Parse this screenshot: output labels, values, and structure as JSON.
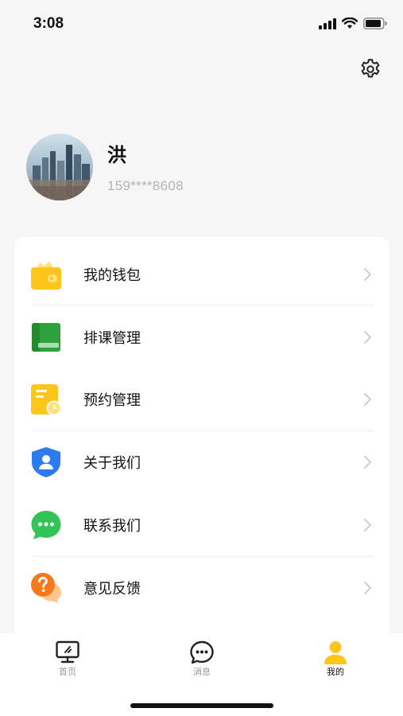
{
  "status_bar": {
    "time": "3:08"
  },
  "profile": {
    "name": "洪",
    "phone": "159****8608"
  },
  "menu": {
    "items": [
      {
        "label": "我的钱包",
        "icon": "wallet-icon",
        "color": "#FFC51B"
      },
      {
        "label": "排课管理",
        "icon": "book-icon",
        "color": "#2DA23C"
      },
      {
        "label": "预约管理",
        "icon": "appointment-icon",
        "color": "#FFC51B"
      },
      {
        "label": "关于我们",
        "icon": "shield-user-icon",
        "color": "#2E7BEF"
      },
      {
        "label": "联系我们",
        "icon": "chat-bubble-icon",
        "color": "#32C454"
      },
      {
        "label": "意见反馈",
        "icon": "feedback-icon",
        "color": "#F7791E"
      }
    ]
  },
  "tab_bar": {
    "tabs": [
      {
        "label": "首页",
        "icon": "monitor-icon",
        "active": false
      },
      {
        "label": "消息",
        "icon": "message-icon",
        "active": false
      },
      {
        "label": "我的",
        "icon": "user-icon",
        "active": true
      }
    ]
  },
  "colors": {
    "accent": "#FFC51B",
    "background": "#F6F6F6",
    "card": "#FFFFFF",
    "secondary_text": "#B3B3B3"
  }
}
